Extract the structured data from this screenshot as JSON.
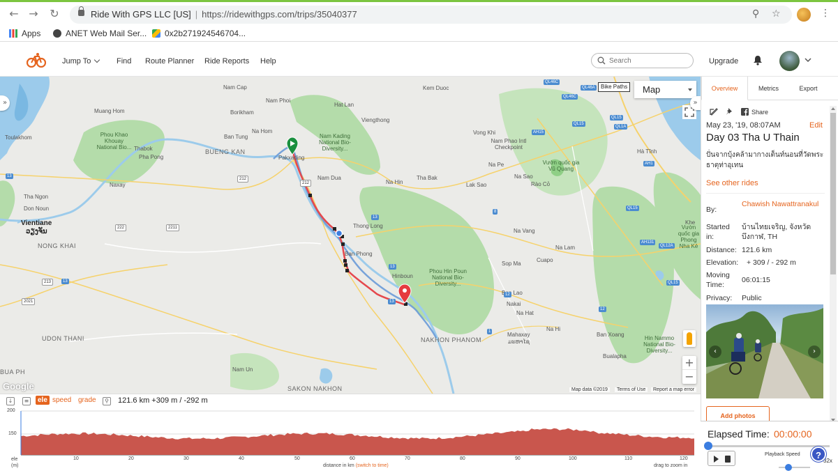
{
  "browser": {
    "site_identity": "Ride With GPS LLC [US]",
    "url": "https://ridewithgps.com/trips/35040377",
    "bookmarks": [
      {
        "label": "Apps",
        "icon": "apps-grid-icon"
      },
      {
        "label": "ANET Web Mail Ser...",
        "icon": "globe-icon"
      },
      {
        "label": "0x2b271924546704...",
        "icon": "google-maps-icon"
      }
    ]
  },
  "header": {
    "nav": [
      "Jump To",
      "Find",
      "Route Planner",
      "Ride Reports",
      "Help"
    ],
    "search_placeholder": "Search",
    "upgrade": "Upgrade"
  },
  "map": {
    "type_label": "Map",
    "bike_paths_label": "Bike Paths",
    "attribution": [
      "Map data ©2019",
      "Terms of Use",
      "Report a map error"
    ],
    "google": "Google",
    "labels": {
      "cities_big": [
        "BUENG KAN",
        "NONG KHAI",
        "UDON THANI",
        "NAKHON PHANOM",
        "SAKON NAKHON",
        "BUA PH"
      ],
      "cities_bold": [
        "Vientiane",
        "ວຽງຈັນ"
      ],
      "places": [
        "Nam Cap",
        "Kem Duoc",
        "Nam Phoi",
        "Hat Lan",
        "Muang Hom",
        "Borikham",
        "Viengthong",
        "Na Hom",
        "Ban Tung",
        "Toulakhom",
        "Thabok",
        "Pha Pong",
        "Pakxading",
        "Nam Dua",
        "Na Hin",
        "Tha Bak",
        "Lak Sao",
        "Na Sao",
        "Na Pe",
        "Vong Khi",
        "Naxay",
        "Tha Ngon",
        "Don Noun",
        "Thong Long",
        "Ban Phong",
        "Hinboun",
        "Na Vang",
        "Na Lam",
        "Sop Ma",
        "Cuapo",
        "Ban Lao",
        "Nakai",
        "Na Hat",
        "Na Hi",
        "Ban Xoang",
        "Mahaxay",
        "ມະຫາໄຊ",
        "Bualapha",
        "Nam Un",
        "Rào Cỏ",
        "Hà Tĩnh",
        "Khe"
      ],
      "protected": [
        "Phou Khao Khouay National Bio...",
        "Nam Kading National Bio-Diversity...",
        "Phou Hin Poun National Bio-Diversity...",
        "Hin Nammo National Bio-Diversity...",
        "Vườn quốc gia Vũ Quang",
        "Nam Phao Intl Checkpoint",
        "Vườn quốc gia Phong Nha Kẻ"
      ],
      "shields": [
        "QL46C",
        "QL46A",
        "QL46C",
        "QL15",
        "AH15",
        "QL15",
        "QL1A",
        "AH1",
        "QL15",
        "QL12A",
        "AH131",
        "QL15",
        "13",
        "13",
        "13",
        "13",
        "212",
        "212",
        "222",
        "2021",
        "2211",
        "1",
        "8",
        "13",
        "12",
        "12",
        "213"
      ]
    }
  },
  "elevation": {
    "toggles": [
      "ele",
      "speed",
      "grade"
    ],
    "summary": "121.6 km +309 m / -292 m",
    "y_ticks": [
      "200",
      "150"
    ],
    "y_unit": [
      "ele",
      "(m)"
    ],
    "x_ticks": [
      "10",
      "20",
      "30",
      "40",
      "50",
      "60",
      "70",
      "80",
      "90",
      "100",
      "110",
      "120"
    ],
    "x_caption": "distance in km",
    "x_switch": "(switch to time)",
    "zoom_hint": "drag to zoom in"
  },
  "sidebar": {
    "tabs": [
      "Overview",
      "Metrics",
      "Export"
    ],
    "share": "Share",
    "date": "May 23, '19, 08:07AM",
    "edit": "Edit",
    "title": "Day 03 Tha U Thain",
    "description": "ปั่นจากบุ้งคล้ามากางเต็นท์นอนที่วัดพระธาตุท่าอุเทน",
    "see_other": "See other rides",
    "details": [
      {
        "label": "By:",
        "value": "Chawish Nawattranakul"
      },
      {
        "label": "Started in:",
        "value": "บ้านไทยเจริญ, จังหวัดบึงกาฬ, TH"
      },
      {
        "label": "Distance:",
        "value": "121.6 km"
      },
      {
        "label": "Elevation:",
        "value": "+ 309 / - 292 m"
      },
      {
        "label": "Moving Time:",
        "value": "06:01:15"
      },
      {
        "label": "Privacy:",
        "value": "Public"
      }
    ],
    "add_photos": "Add photos"
  },
  "playback": {
    "elapsed_label": "Elapsed Time:",
    "elapsed_value": "00:00:00",
    "speed_label": "Playback Speed",
    "speed_value": "32x",
    "speed_fraction": 0.2,
    "progress_fraction": 0.0
  },
  "colors": {
    "accent": "#e5641e",
    "route_blue": "#6a9bd8",
    "route_red": "#e5484d",
    "elevation_fill": "#c9564d",
    "park_green": "#a8d8a0"
  }
}
